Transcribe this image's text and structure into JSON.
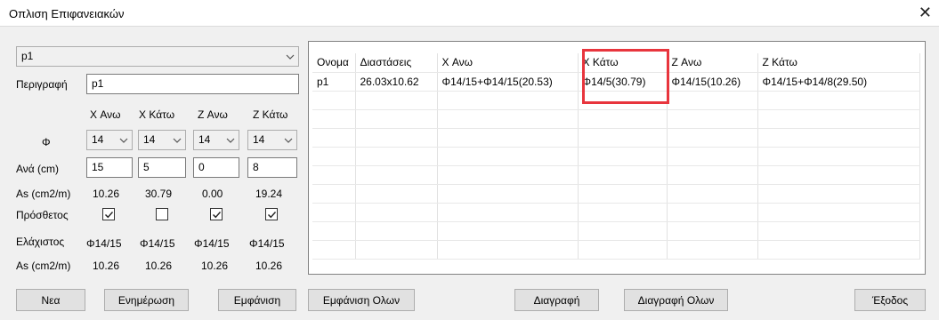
{
  "window": {
    "title": "Οπλιση Επιφανειακών",
    "close_glyph": "✕"
  },
  "left": {
    "selector_value": "p1",
    "description_label": "Περιγραφή",
    "description_value": "p1",
    "columns": [
      "X Ανω",
      "X Κάτω",
      "Z Ανω",
      "Z Κάτω"
    ],
    "phi_label": "Φ",
    "phi_values": [
      "14",
      "14",
      "14",
      "14"
    ],
    "spacing_label": "Ανά (cm)",
    "spacing_values": [
      "15",
      "5",
      "0",
      "8"
    ],
    "as_label": "As (cm2/m)",
    "as_values": [
      "10.26",
      "30.79",
      "0.00",
      "19.24"
    ],
    "additional_label": "Πρόσθετος",
    "additional_checked": [
      true,
      false,
      true,
      true
    ],
    "min_label": "Ελάχιστος",
    "min_values": [
      "Φ14/15",
      "Φ14/15",
      "Φ14/15",
      "Φ14/15"
    ],
    "as_min_label": "As (cm2/m)",
    "as_min_values": [
      "10.26",
      "10.26",
      "10.26",
      "10.26"
    ]
  },
  "chart_data": {
    "type": "table",
    "columns": [
      "Ονομα",
      "Διαστάσεις",
      "X Ανω",
      "X Κάτω",
      "Z Ανω",
      "Z Κάτω"
    ],
    "rows": [
      [
        "p1",
        "26.03x10.62",
        "Φ14/15+Φ14/15(20.53)",
        "Φ14/5(30.79)",
        "Φ14/15(10.26)",
        "Φ14/15+Φ14/8(29.50)"
      ]
    ],
    "highlighted_column": "X Κάτω",
    "highlight_color": "#e8353d"
  },
  "buttons": {
    "new": "Νεα",
    "update": "Ενημέρωση",
    "show": "Εμφάνιση",
    "show_all": "Εμφάνιση Ολων",
    "delete": "Διαγραφή",
    "delete_all": "Διαγραφή Ολων",
    "exit": "Έξοδος"
  }
}
